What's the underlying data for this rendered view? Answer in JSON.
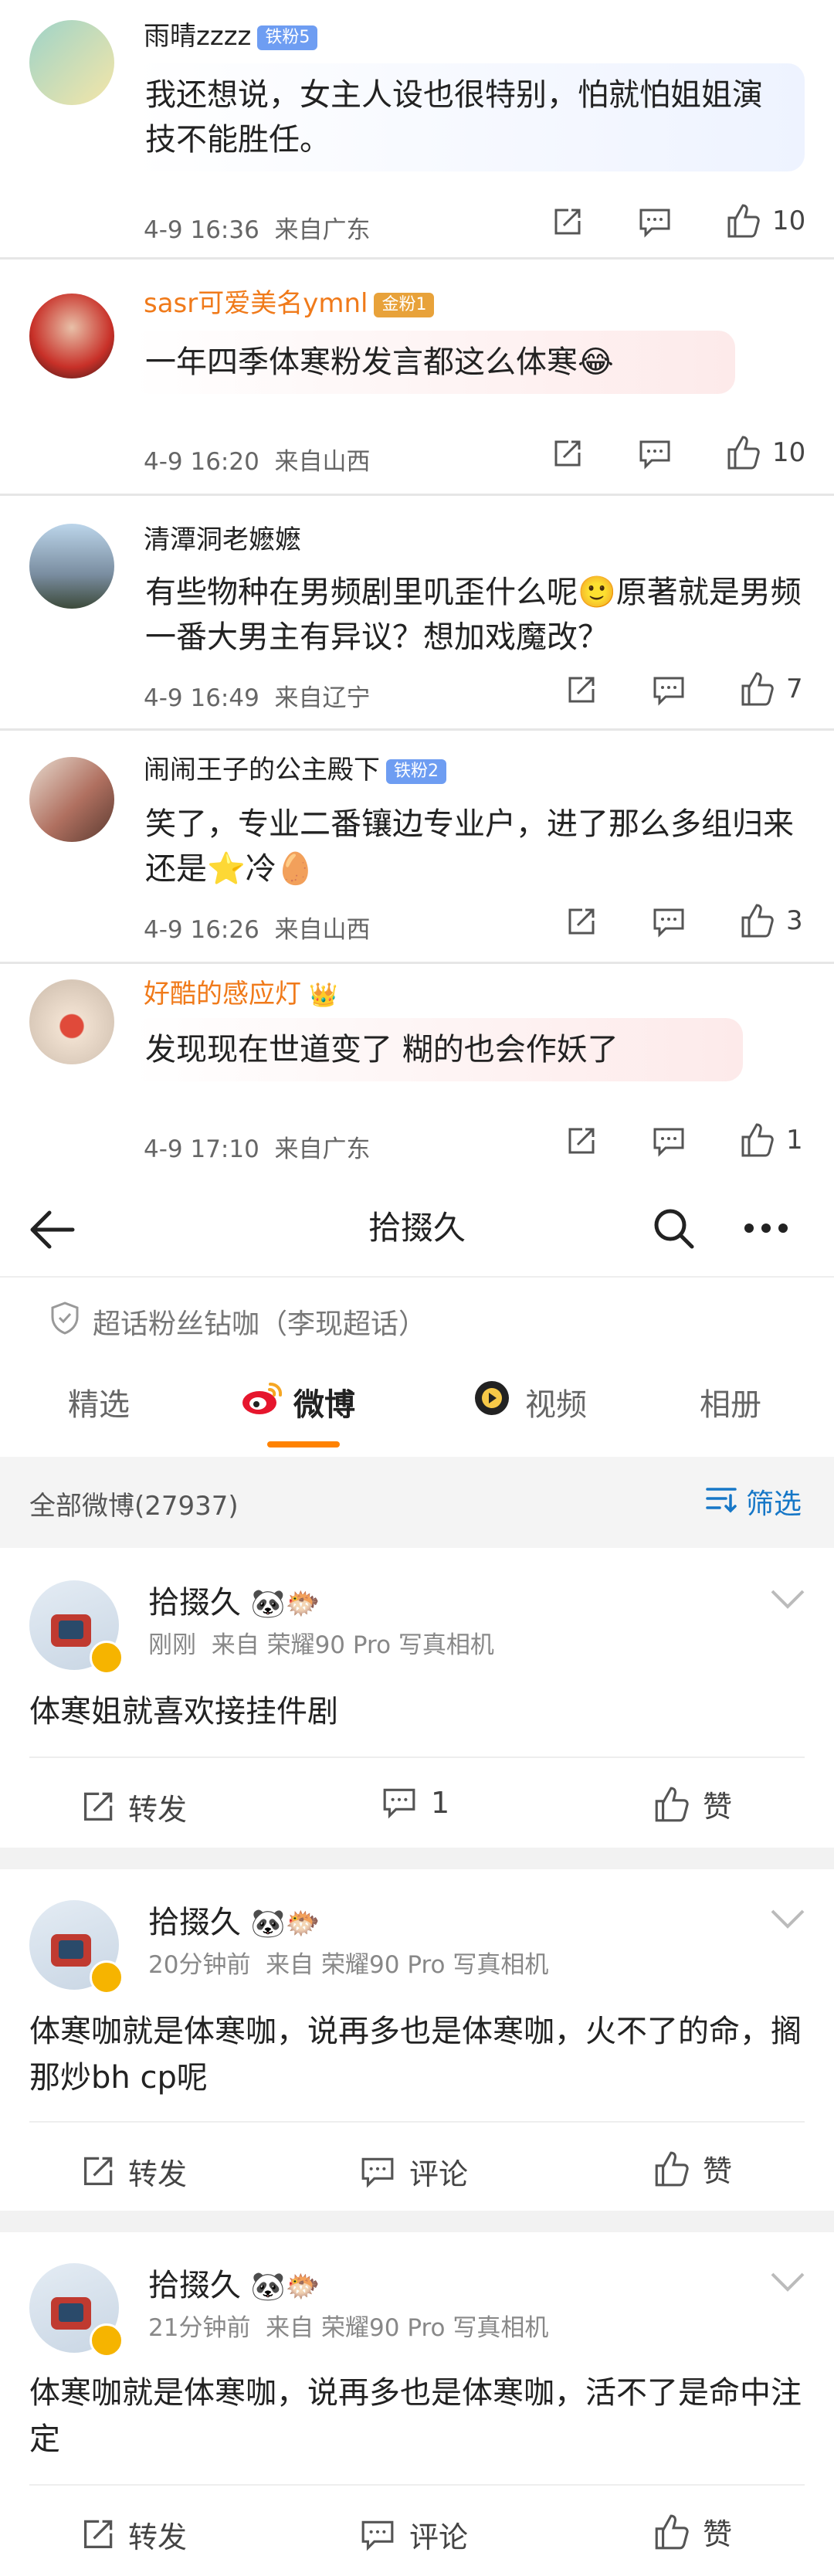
{
  "comments": [
    {
      "username": "雨晴zzzz",
      "badge": "铁粉5",
      "text": "我还想说，女主人设也很特别，怕就怕姐姐演技不能胜任。",
      "date": "4-9 16:36",
      "location": "来自广东",
      "likes": "10"
    },
    {
      "username": "sasr可爱美名ymnl",
      "badge": "金粉1",
      "text": "一年四季体寒粉发言都这么体寒😂",
      "date": "4-9 16:20",
      "location": "来自山西",
      "likes": "10"
    },
    {
      "username": "清潭洞老嬷嬷",
      "badge": "",
      "text": "有些物种在男频剧里叽歪什么呢🙂原著就是男频一番大男主有异议？想加戏魔改？",
      "date": "4-9 16:49",
      "location": "来自辽宁",
      "likes": "7"
    },
    {
      "username": "闹闹王子的公主殿下",
      "badge": "铁粉2",
      "text": "笑了，专业二番镶边专业户，进了那么多组归来还是⭐冷🥚",
      "date": "4-9 16:26",
      "location": "来自山西",
      "likes": "3"
    },
    {
      "username": "好酷的感应灯",
      "badge": "👑",
      "text": "发现现在世道变了 糊的也会作妖了",
      "date": "4-9 17:10",
      "location": "来自广东",
      "likes": "1"
    }
  ],
  "topic": {
    "title": "拾掇久",
    "supertopic": "超话粉丝钻咖（李现超话）",
    "tabs": [
      "精选",
      "微博",
      "视频",
      "相册"
    ],
    "filter_label": "全部微博(27937)",
    "filter_button": "筛选"
  },
  "posts": [
    {
      "author": "拾掇久",
      "emoji": "🐼🐡",
      "time": "刚刚",
      "source": "来自 荣耀90 Pro 写真相机",
      "text": "体寒姐就喜欢接挂件剧",
      "repost": "转发",
      "comment": "1",
      "like": "赞"
    },
    {
      "author": "拾掇久",
      "emoji": "🐼🐡",
      "time": "20分钟前",
      "source": "来自 荣耀90 Pro 写真相机",
      "text": "体寒咖就是体寒咖，说再多也是体寒咖，火不了的命，搁那炒bh cp呢",
      "repost": "转发",
      "comment": "评论",
      "like": "赞"
    },
    {
      "author": "拾掇久",
      "emoji": "🐼🐡",
      "time": "21分钟前",
      "source": "来自 荣耀90 Pro 写真相机",
      "text": "体寒咖就是体寒咖，说再多也是体寒咖，活不了是命中注定",
      "repost": "转发",
      "comment": "评论",
      "like": "赞"
    }
  ],
  "colors": {
    "accent": "#ff8200",
    "link": "#1677c7",
    "username_orange": "#f07a1a",
    "badge_blue": "#6e9df2"
  }
}
